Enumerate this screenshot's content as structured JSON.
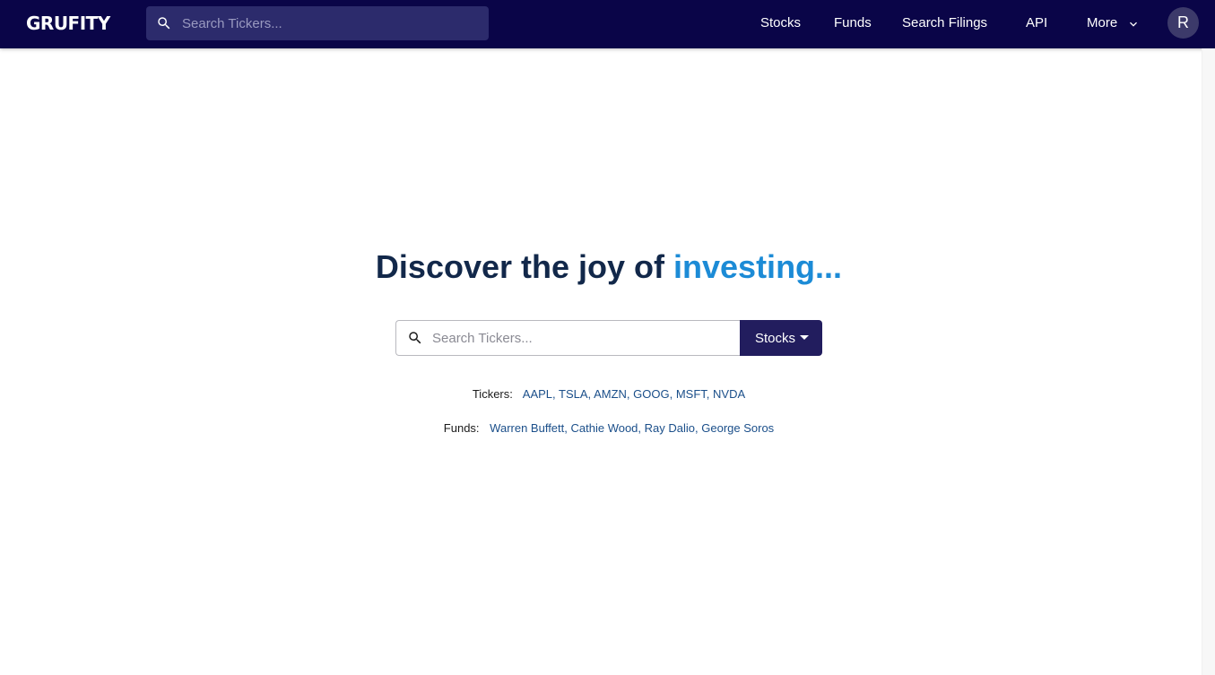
{
  "navbar": {
    "logo": "GRUFITY",
    "search_placeholder": "Search Tickers...",
    "links": [
      "Stocks",
      "Funds",
      "Search Filings",
      "API",
      "More"
    ],
    "avatar_initial": "R"
  },
  "hero": {
    "title_prefix": "Discover the joy of ",
    "title_accent": "investing...",
    "search_placeholder": "Search Tickers...",
    "type_selected": "Stocks"
  },
  "quick_links": {
    "tickers_label": "Tickers:",
    "tickers": [
      "AAPL",
      "TSLA",
      "AMZN",
      "GOOG",
      "MSFT",
      "NVDA"
    ],
    "funds_label": "Funds:",
    "funds": [
      "Warren Buffett",
      "Cathie Wood",
      "Ray Dalio",
      "George Soros"
    ]
  },
  "colors": {
    "navbar_bg": "#0a0548",
    "nav_search_bg": "#2c2b6c",
    "title_text": "#12284a",
    "title_accent": "#1c8bd6",
    "type_button_bg": "#221d5e",
    "link_text": "#1b4f8a"
  },
  "icons": {
    "nav_search": "search-icon",
    "more": "chevron-down-icon",
    "main_search": "search-icon",
    "type_dropdown": "caret-down-icon"
  }
}
